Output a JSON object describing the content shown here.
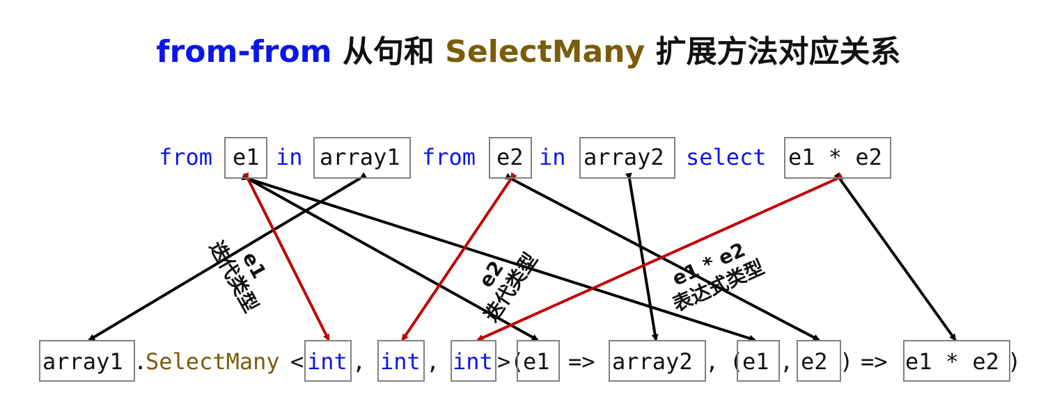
{
  "title": {
    "part1": "from-from",
    "part2": " 从句和 ",
    "part3": "SelectMany",
    "part4": " 扩展方法对应关系"
  },
  "query": {
    "from1": "from",
    "e1": "e1",
    "in1": "in",
    "array1": "array1",
    "from2": "from",
    "e2": "e2",
    "in2": "in",
    "array2": "array2",
    "select": "select",
    "expr": "e1 * e2"
  },
  "method": {
    "array1": "array1",
    "dot": ".",
    "name": "SelectMany",
    "lt": "<",
    "t1": "int",
    "c1": ",",
    "t2": "int",
    "c2": ",",
    "t3": "int",
    "gt": ">(",
    "p1": "e1",
    "arrow1": "=>",
    "array2": "array2",
    "c3": ",",
    "open": "(",
    "p2": "e1",
    "c4": ",",
    "p3": "e2",
    "close": ")",
    "arrow2": "=>",
    "expr": "e1 * e2",
    "end": ")"
  },
  "labels": {
    "iter1_name": "e1",
    "iter1_desc": "迭代类型",
    "iter2_name": "e2",
    "iter2_desc": "迭代类型",
    "expr_name": "e1 * e2",
    "expr_desc": "表达式类型"
  },
  "colors": {
    "keyword": "#0a17e6",
    "method": "#7a5c0a",
    "red_arrow": "#c00000",
    "black_arrow": "#000000",
    "box_border": "#808080"
  }
}
